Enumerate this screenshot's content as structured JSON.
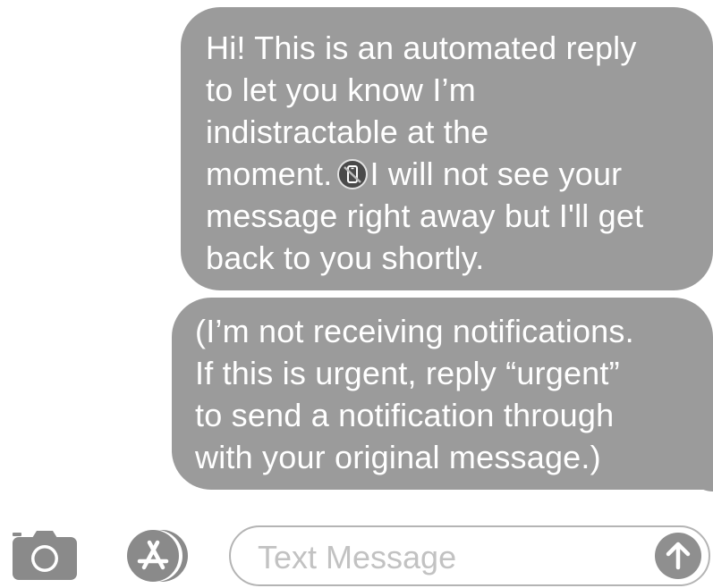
{
  "messages": [
    {
      "lines": [
        "Hi! This is an automated reply",
        "to let you know I’m",
        "indistractable at the",
        "moment.",
        "I will not see your",
        "message right away but I'll get",
        "back to you shortly."
      ],
      "inline_icon": "phone-crossed-out-icon"
    },
    {
      "lines": [
        "(I’m not receiving notifications.",
        "If this is urgent, reply “urgent”",
        "to send a notification through",
        "with your original message.)"
      ]
    }
  ],
  "input_bar": {
    "placeholder": "Text Message",
    "camera_icon": "camera-icon",
    "apps_icon": "app-store-icon",
    "send_icon": "arrow-up-icon"
  },
  "colors": {
    "bubble": "#9b9b9b",
    "bubble_text": "#ffffff",
    "icon": "#8a8a8a",
    "placeholder": "#c2c2c2"
  }
}
